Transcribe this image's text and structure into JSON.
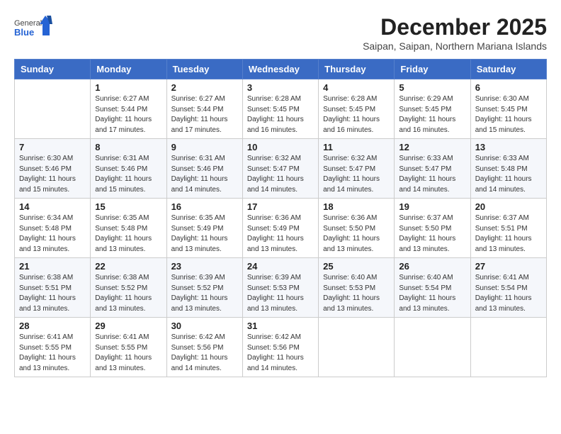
{
  "header": {
    "logo_general": "General",
    "logo_blue": "Blue",
    "month_year": "December 2025",
    "location": "Saipan, Saipan, Northern Mariana Islands"
  },
  "days_of_week": [
    "Sunday",
    "Monday",
    "Tuesday",
    "Wednesday",
    "Thursday",
    "Friday",
    "Saturday"
  ],
  "weeks": [
    [
      {
        "day": "",
        "info": ""
      },
      {
        "day": "1",
        "info": "Sunrise: 6:27 AM\nSunset: 5:44 PM\nDaylight: 11 hours\nand 17 minutes."
      },
      {
        "day": "2",
        "info": "Sunrise: 6:27 AM\nSunset: 5:44 PM\nDaylight: 11 hours\nand 17 minutes."
      },
      {
        "day": "3",
        "info": "Sunrise: 6:28 AM\nSunset: 5:45 PM\nDaylight: 11 hours\nand 16 minutes."
      },
      {
        "day": "4",
        "info": "Sunrise: 6:28 AM\nSunset: 5:45 PM\nDaylight: 11 hours\nand 16 minutes."
      },
      {
        "day": "5",
        "info": "Sunrise: 6:29 AM\nSunset: 5:45 PM\nDaylight: 11 hours\nand 16 minutes."
      },
      {
        "day": "6",
        "info": "Sunrise: 6:30 AM\nSunset: 5:45 PM\nDaylight: 11 hours\nand 15 minutes."
      }
    ],
    [
      {
        "day": "7",
        "info": "Sunrise: 6:30 AM\nSunset: 5:46 PM\nDaylight: 11 hours\nand 15 minutes."
      },
      {
        "day": "8",
        "info": "Sunrise: 6:31 AM\nSunset: 5:46 PM\nDaylight: 11 hours\nand 15 minutes."
      },
      {
        "day": "9",
        "info": "Sunrise: 6:31 AM\nSunset: 5:46 PM\nDaylight: 11 hours\nand 14 minutes."
      },
      {
        "day": "10",
        "info": "Sunrise: 6:32 AM\nSunset: 5:47 PM\nDaylight: 11 hours\nand 14 minutes."
      },
      {
        "day": "11",
        "info": "Sunrise: 6:32 AM\nSunset: 5:47 PM\nDaylight: 11 hours\nand 14 minutes."
      },
      {
        "day": "12",
        "info": "Sunrise: 6:33 AM\nSunset: 5:47 PM\nDaylight: 11 hours\nand 14 minutes."
      },
      {
        "day": "13",
        "info": "Sunrise: 6:33 AM\nSunset: 5:48 PM\nDaylight: 11 hours\nand 14 minutes."
      }
    ],
    [
      {
        "day": "14",
        "info": "Sunrise: 6:34 AM\nSunset: 5:48 PM\nDaylight: 11 hours\nand 13 minutes."
      },
      {
        "day": "15",
        "info": "Sunrise: 6:35 AM\nSunset: 5:48 PM\nDaylight: 11 hours\nand 13 minutes."
      },
      {
        "day": "16",
        "info": "Sunrise: 6:35 AM\nSunset: 5:49 PM\nDaylight: 11 hours\nand 13 minutes."
      },
      {
        "day": "17",
        "info": "Sunrise: 6:36 AM\nSunset: 5:49 PM\nDaylight: 11 hours\nand 13 minutes."
      },
      {
        "day": "18",
        "info": "Sunrise: 6:36 AM\nSunset: 5:50 PM\nDaylight: 11 hours\nand 13 minutes."
      },
      {
        "day": "19",
        "info": "Sunrise: 6:37 AM\nSunset: 5:50 PM\nDaylight: 11 hours\nand 13 minutes."
      },
      {
        "day": "20",
        "info": "Sunrise: 6:37 AM\nSunset: 5:51 PM\nDaylight: 11 hours\nand 13 minutes."
      }
    ],
    [
      {
        "day": "21",
        "info": "Sunrise: 6:38 AM\nSunset: 5:51 PM\nDaylight: 11 hours\nand 13 minutes."
      },
      {
        "day": "22",
        "info": "Sunrise: 6:38 AM\nSunset: 5:52 PM\nDaylight: 11 hours\nand 13 minutes."
      },
      {
        "day": "23",
        "info": "Sunrise: 6:39 AM\nSunset: 5:52 PM\nDaylight: 11 hours\nand 13 minutes."
      },
      {
        "day": "24",
        "info": "Sunrise: 6:39 AM\nSunset: 5:53 PM\nDaylight: 11 hours\nand 13 minutes."
      },
      {
        "day": "25",
        "info": "Sunrise: 6:40 AM\nSunset: 5:53 PM\nDaylight: 11 hours\nand 13 minutes."
      },
      {
        "day": "26",
        "info": "Sunrise: 6:40 AM\nSunset: 5:54 PM\nDaylight: 11 hours\nand 13 minutes."
      },
      {
        "day": "27",
        "info": "Sunrise: 6:41 AM\nSunset: 5:54 PM\nDaylight: 11 hours\nand 13 minutes."
      }
    ],
    [
      {
        "day": "28",
        "info": "Sunrise: 6:41 AM\nSunset: 5:55 PM\nDaylight: 11 hours\nand 13 minutes."
      },
      {
        "day": "29",
        "info": "Sunrise: 6:41 AM\nSunset: 5:55 PM\nDaylight: 11 hours\nand 13 minutes."
      },
      {
        "day": "30",
        "info": "Sunrise: 6:42 AM\nSunset: 5:56 PM\nDaylight: 11 hours\nand 14 minutes."
      },
      {
        "day": "31",
        "info": "Sunrise: 6:42 AM\nSunset: 5:56 PM\nDaylight: 11 hours\nand 14 minutes."
      },
      {
        "day": "",
        "info": ""
      },
      {
        "day": "",
        "info": ""
      },
      {
        "day": "",
        "info": ""
      }
    ]
  ]
}
